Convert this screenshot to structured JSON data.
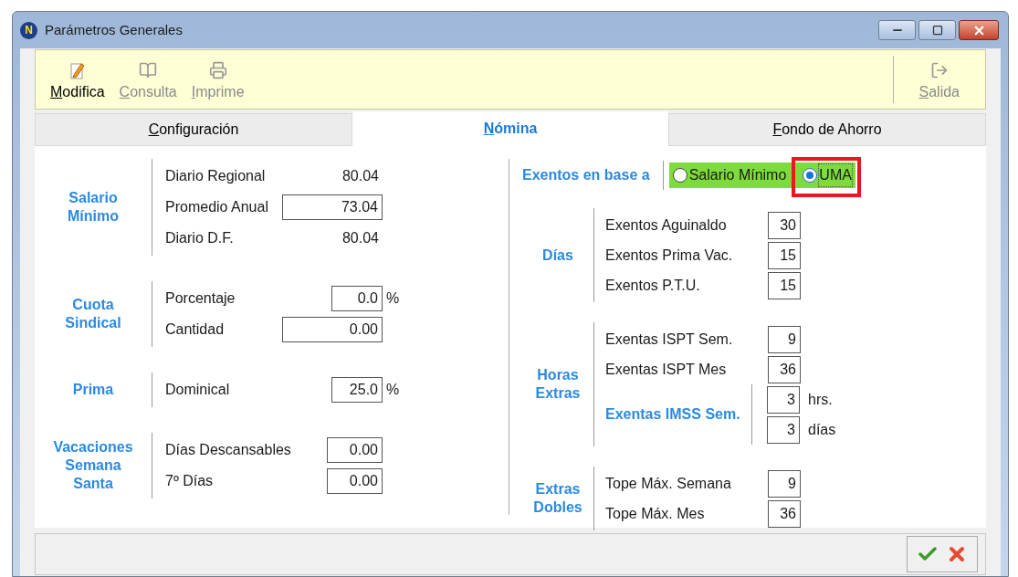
{
  "window": {
    "logo": "N",
    "title": "Parámetros Generales"
  },
  "toolbar": {
    "buttons": [
      {
        "label": "Modifica",
        "kind": "edit",
        "disabled": false
      },
      {
        "label": "Consulta",
        "kind": "view",
        "disabled": true
      },
      {
        "label": "Imprime",
        "kind": "print",
        "disabled": true
      }
    ],
    "exit": {
      "label": "Salida",
      "kind": "exit",
      "disabled": true
    }
  },
  "tabs": [
    {
      "label": "Configuración",
      "selected": false
    },
    {
      "label": "Nómina",
      "selected": true
    },
    {
      "label": "Fondo de Ahorro",
      "selected": false
    }
  ],
  "left_groups": [
    {
      "title": "Salario Mínimo",
      "rows": [
        {
          "label": "Diario Regional",
          "value": "80.04",
          "kind": "text"
        },
        {
          "label": "Promedio Anual",
          "value": "73.04",
          "kind": "wide_field"
        },
        {
          "label": "Diario D.F.",
          "value": "80.04",
          "kind": "text"
        }
      ]
    },
    {
      "title": "Cuota Sindical",
      "rows": [
        {
          "label": "Porcentaje",
          "value": "0.0",
          "kind": "field",
          "unit": "%"
        },
        {
          "label": "Cantidad",
          "value": "0.00",
          "kind": "wide_field"
        }
      ]
    },
    {
      "title": "Prima",
      "rows": [
        {
          "label": "Dominical",
          "value": "25.0",
          "kind": "field",
          "unit": "%"
        }
      ]
    },
    {
      "title": "Vacaciones Semana Santa",
      "rows": [
        {
          "label": "Días Descansables",
          "value": "0.00",
          "kind": "field"
        },
        {
          "label": "7º Días",
          "value": "0.00",
          "kind": "field"
        }
      ]
    }
  ],
  "exentos": {
    "label": "Exentos en base a",
    "options": [
      {
        "label": "Salario Mínimo",
        "selected": false,
        "highlighted": false
      },
      {
        "label": "UMA",
        "selected": true,
        "highlighted": true
      }
    ]
  },
  "right_groups": [
    {
      "title": "Días",
      "rows": [
        {
          "label": "Exentos Aguinaldo",
          "value": "30"
        },
        {
          "label": "Exentos Prima Vac.",
          "value": "15"
        },
        {
          "label": "Exentos P.T.U.",
          "value": "15"
        }
      ]
    },
    {
      "title": "Horas Extras",
      "rows": [
        {
          "label": "Exentas ISPT Sem.",
          "value": "9"
        },
        {
          "label": "Exentas ISPT Mes",
          "value": "36"
        }
      ],
      "subgroup": {
        "title": "Exentas IMSS Sem.",
        "rows": [
          {
            "value": "3",
            "unit": "hrs."
          },
          {
            "value": "3",
            "unit": "días"
          }
        ]
      }
    },
    {
      "title": "Extras Dobles",
      "rows": [
        {
          "label": "Tope Máx. Semana",
          "value": "9"
        },
        {
          "label": "Tope Máx. Mes",
          "value": "36"
        }
      ]
    }
  ]
}
